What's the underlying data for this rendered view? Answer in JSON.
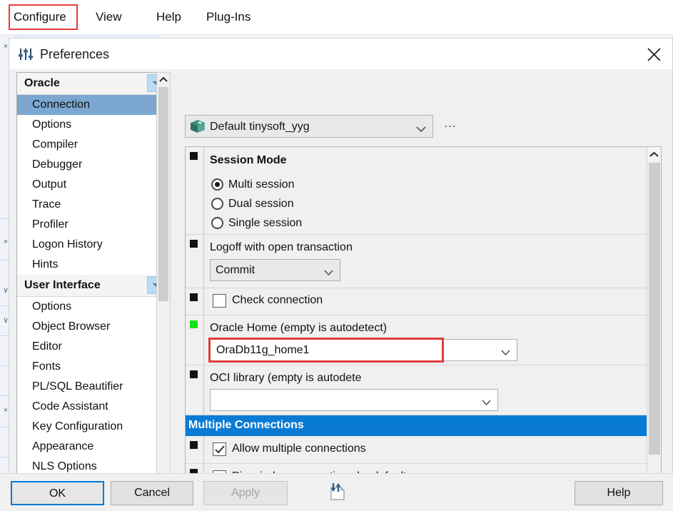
{
  "menubar": {
    "items": [
      {
        "label": "Configure",
        "highlighted": true
      },
      {
        "label": "View",
        "highlighted": false
      },
      {
        "label": "Help",
        "highlighted": false
      },
      {
        "label": "Plug-Ins",
        "highlighted": false
      }
    ]
  },
  "dialog": {
    "title": "Preferences",
    "title_icon": "sliders-icon",
    "close_icon": "close-icon"
  },
  "sidebar": {
    "groups": [
      {
        "header": "Oracle",
        "items": [
          {
            "label": "Connection",
            "selected": true
          },
          {
            "label": "Options",
            "selected": false
          },
          {
            "label": "Compiler",
            "selected": false
          },
          {
            "label": "Debugger",
            "selected": false
          },
          {
            "label": "Output",
            "selected": false
          },
          {
            "label": "Trace",
            "selected": false
          },
          {
            "label": "Profiler",
            "selected": false
          },
          {
            "label": "Logon History",
            "selected": false
          },
          {
            "label": "Hints",
            "selected": false
          }
        ]
      },
      {
        "header": "User Interface",
        "items": [
          {
            "label": "Options",
            "selected": false
          },
          {
            "label": "Object Browser",
            "selected": false
          },
          {
            "label": "Editor",
            "selected": false
          },
          {
            "label": "Fonts",
            "selected": false
          },
          {
            "label": "PL/SQL Beautifier",
            "selected": false
          },
          {
            "label": "Code Assistant",
            "selected": false
          },
          {
            "label": "Key Configuration",
            "selected": false
          },
          {
            "label": "Appearance",
            "selected": false
          },
          {
            "label": "NLS Options",
            "selected": false
          }
        ]
      }
    ]
  },
  "toolbar": {
    "connection_profile": "Default tinysoft_yyg",
    "profile_icon": "package-icon",
    "more_button": "..."
  },
  "settings": {
    "session_mode": {
      "title": "Session Mode",
      "options": [
        {
          "label": "Multi session",
          "selected": true
        },
        {
          "label": "Dual session",
          "selected": false
        },
        {
          "label": "Single session",
          "selected": false
        }
      ]
    },
    "logoff": {
      "label": "Logoff with open transaction",
      "value": "Commit"
    },
    "check_connection": {
      "label": "Check connection",
      "checked": false
    },
    "oracle_home": {
      "label": "Oracle Home (empty is autodetect)",
      "value": "OraDb11g_home1",
      "highlighted": true,
      "modified": true
    },
    "oci_library": {
      "label": "OCI library (empty is autodete",
      "value": ""
    },
    "multiple_connections": {
      "header": "Multiple Connections",
      "allow": {
        "label": "Allow multiple connections",
        "checked": true
      },
      "pin": {
        "label": "Pin window connections by default",
        "checked": false
      }
    }
  },
  "footer": {
    "ok": "OK",
    "cancel": "Cancel",
    "apply": "Apply",
    "help": "Help",
    "import_export_icon": "import-export-icon"
  },
  "colors": {
    "accent": "#0a7bd4",
    "selection": "#7ba7d1",
    "highlight_red": "#e03b3b",
    "modified_green": "#17e017"
  }
}
